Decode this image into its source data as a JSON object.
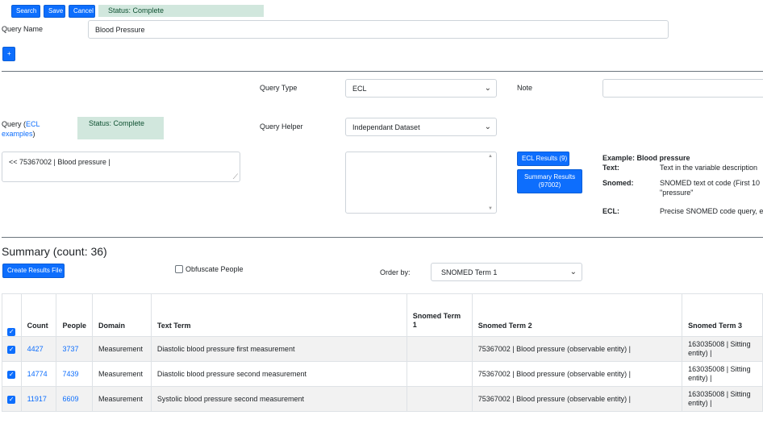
{
  "toolbar": {
    "search_label": "Search",
    "save_label": "Save",
    "cancel_label": "Cancel",
    "status": "Status: Complete"
  },
  "query_name": {
    "label": "Query Name",
    "value": "Blood Pressure"
  },
  "add_button": "+",
  "query_type": {
    "label": "Query Type",
    "value": "ECL"
  },
  "note": {
    "label": "Note",
    "value": ""
  },
  "query": {
    "label_prefix": "Query (",
    "link_text": "ECL examples",
    "label_suffix": ")",
    "status": "Status: Complete",
    "value": "<< 75367002 | Blood pressure |"
  },
  "query_helper": {
    "label": "Query Helper",
    "value": "Independant Dataset"
  },
  "results": {
    "ecl_results": "ECL Results (9)",
    "summary_results_line1": "Summary Results",
    "summary_results_line2": "(97002)"
  },
  "example": {
    "title": "Example: Blood pressure",
    "rows": [
      {
        "key": "Text:",
        "value": "Text in the variable description"
      },
      {
        "key": "Snomed:",
        "value": "SNOMED text ot code (First 10",
        "value2": "\"pressure\""
      },
      {
        "key": "ECL:",
        "value": "Precise SNOMED code query, e"
      }
    ]
  },
  "summary": {
    "title": "Summary (count: 36)",
    "create_button": "Create Results File",
    "obfuscate_label": "Obfuscate People",
    "order_by_label": "Order by:",
    "order_by_value": "SNOMED Term 1"
  },
  "table": {
    "headers": [
      "Count",
      "People",
      "Domain",
      "Text Term",
      "Snomed Term 1",
      "Snomed Term 2",
      "Snomed Term 3"
    ],
    "rows": [
      {
        "count": "4427",
        "people": "3737",
        "domain": "Measurement",
        "text_term": "Diastolic blood pressure first measurement",
        "snomed1": "",
        "snomed2": "75367002 | Blood pressure (observable entity) |",
        "snomed3_l1": "163035008 | Sitting",
        "snomed3_l2": "entity) |"
      },
      {
        "count": "14774",
        "people": "7439",
        "domain": "Measurement",
        "text_term": "Diastolic blood pressure second measurement",
        "snomed1": "",
        "snomed2": "75367002 | Blood pressure (observable entity) |",
        "snomed3_l1": "163035008 | Sitting",
        "snomed3_l2": "entity) |"
      },
      {
        "count": "11917",
        "people": "6609",
        "domain": "Measurement",
        "text_term": "Systolic blood pressure second measurement",
        "snomed1": "",
        "snomed2": "75367002 | Blood pressure (observable entity) |",
        "snomed3_l1": "163035008 | Sitting",
        "snomed3_l2": "entity) |"
      }
    ]
  },
  "colors": {
    "primary": "#0d6efd",
    "status_bg": "#d1e7dd",
    "row_alt": "#f2f2f2"
  }
}
